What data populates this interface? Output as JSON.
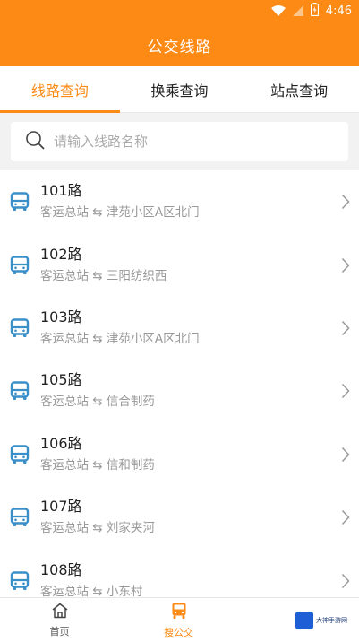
{
  "status_bar": {
    "time": "4:46"
  },
  "header": {
    "title": "公交线路"
  },
  "tabs": [
    {
      "label": "线路查询",
      "active": true
    },
    {
      "label": "换乘查询",
      "active": false
    },
    {
      "label": "站点查询",
      "active": false
    }
  ],
  "search": {
    "placeholder": "请输入线路名称"
  },
  "routes": [
    {
      "name": "101路",
      "from": "客运总站",
      "to": "津苑小区A区北门"
    },
    {
      "name": "102路",
      "from": "客运总站",
      "to": "三阳纺织西"
    },
    {
      "name": "103路",
      "from": "客运总站",
      "to": "津苑小区A区北门"
    },
    {
      "name": "105路",
      "from": "客运总站",
      "to": "信合制药"
    },
    {
      "name": "106路",
      "from": "客运总站",
      "to": "信和制药"
    },
    {
      "name": "107路",
      "from": "客运总站",
      "to": "刘家夹河"
    },
    {
      "name": "108路",
      "from": "客运总站",
      "to": "小东村"
    }
  ],
  "bottom_nav": [
    {
      "label": "首页",
      "icon": "home-icon",
      "active": false
    },
    {
      "label": "搜公交",
      "icon": "bus-icon",
      "active": true
    }
  ],
  "watermark": {
    "text": "大神手游网"
  },
  "colors": {
    "accent": "#fd8a14",
    "bus_icon": "#3a8fc9"
  }
}
